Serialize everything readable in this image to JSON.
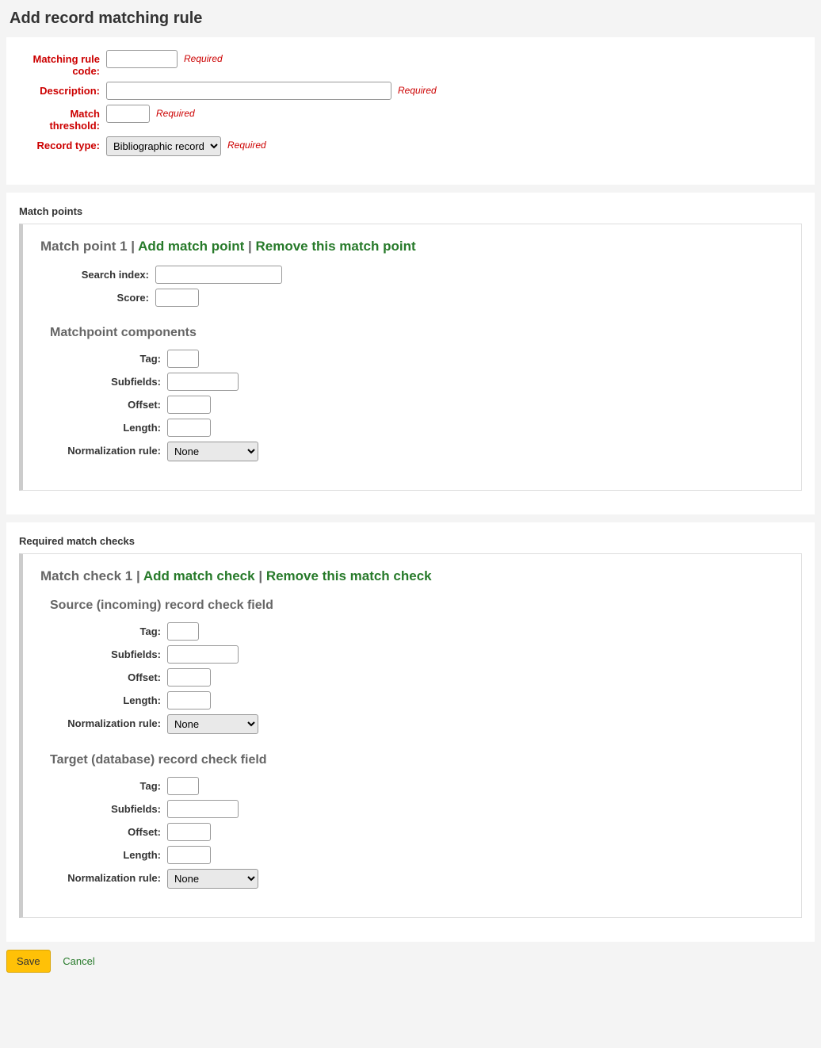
{
  "page_title": "Add record matching rule",
  "required_hint": "Required",
  "main_fields": {
    "code_label": "Matching rule code:",
    "description_label": "Description:",
    "threshold_label": "Match threshold:",
    "record_type_label": "Record type:",
    "record_type_selected": "Bibliographic record"
  },
  "match_points": {
    "section_title": "Match points",
    "heading_prefix": "Match point 1",
    "add_link": "Add match point",
    "remove_link": "Remove this match point",
    "search_index_label": "Search index:",
    "score_label": "Score:",
    "components_title": "Matchpoint components",
    "tag_label": "Tag:",
    "subfields_label": "Subfields:",
    "offset_label": "Offset:",
    "length_label": "Length:",
    "norm_label": "Normalization rule:",
    "norm_selected": "None"
  },
  "match_checks": {
    "section_title": "Required match checks",
    "heading_prefix": "Match check 1",
    "add_link": "Add match check",
    "remove_link": "Remove this match check",
    "source_title": "Source (incoming) record check field",
    "target_title": "Target (database) record check field",
    "tag_label": "Tag:",
    "subfields_label": "Subfields:",
    "offset_label": "Offset:",
    "length_label": "Length:",
    "norm_label": "Normalization rule:",
    "norm_selected": "None"
  },
  "actions": {
    "save": "Save",
    "cancel": "Cancel"
  }
}
